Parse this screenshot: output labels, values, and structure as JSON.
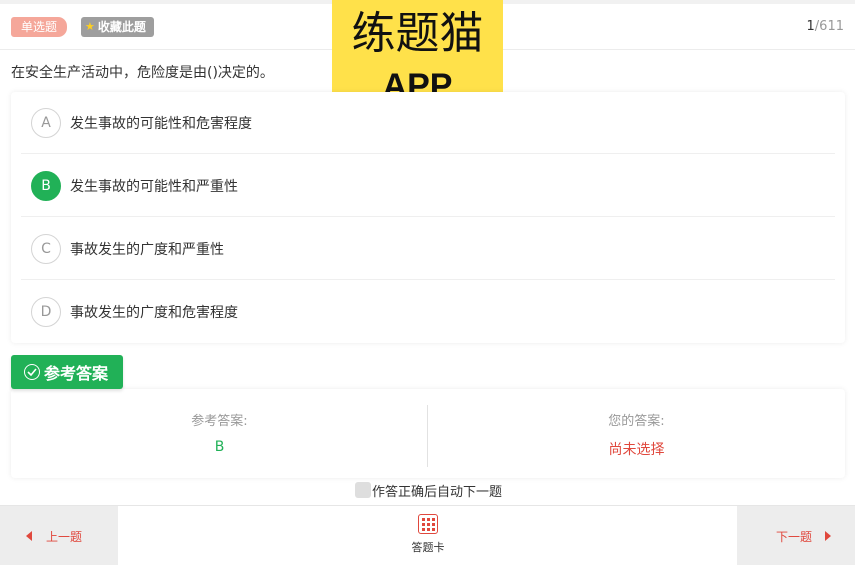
{
  "header": {
    "type_tag": "单选题",
    "favorite_label": "收藏此题",
    "progress_current": "1",
    "progress_total": "/611"
  },
  "banner": {
    "line1": "练题猫",
    "line2": "APP",
    "color": "#ffe14a"
  },
  "question": {
    "text": "在安全生产活动中，危险度是由()决定的。",
    "options": [
      {
        "letter": "A",
        "text": "发生事故的可能性和危害程度",
        "selected": false
      },
      {
        "letter": "B",
        "text": "发生事故的可能性和严重性",
        "selected": true
      },
      {
        "letter": "C",
        "text": "事故发生的广度和严重性",
        "selected": false
      },
      {
        "letter": "D",
        "text": "事故发生的广度和危害程度",
        "selected": false
      }
    ]
  },
  "answer": {
    "section_label": "参考答案",
    "reference_label": "参考答案:",
    "reference_value": "B",
    "yours_label": "您的答案:",
    "yours_value": "尚未选择"
  },
  "auto_next_label": "作答正确后自动下一题",
  "footer": {
    "prev_label": "上一题",
    "card_label": "答题卡",
    "next_label": "下一题"
  },
  "colors": {
    "accent_green": "#21b157",
    "accent_red": "#e0483d",
    "tag_pink": "#f5a79a"
  }
}
